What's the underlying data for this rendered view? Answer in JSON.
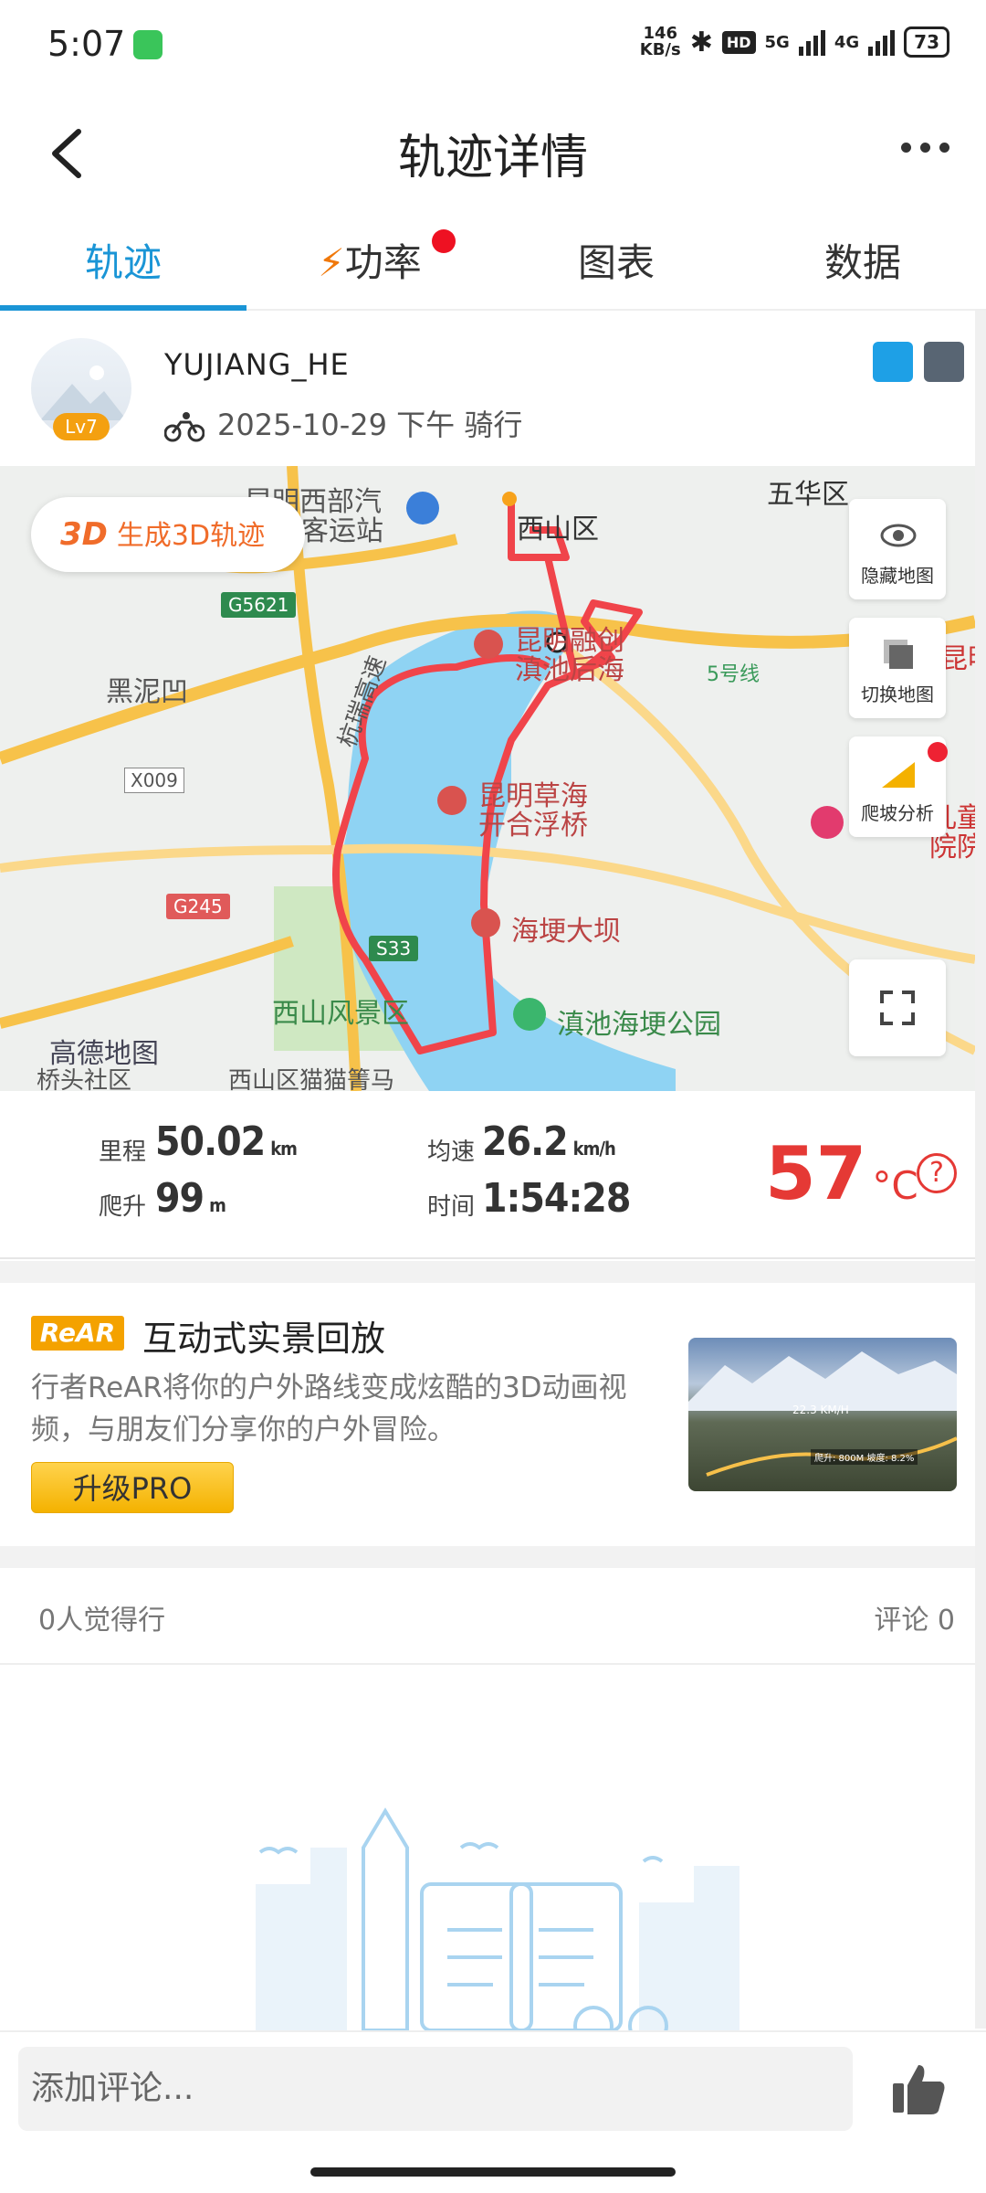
{
  "status_bar": {
    "time": "5:07",
    "net_speed_top": "146",
    "net_speed_bottom": "KB/s",
    "hd": "HD",
    "sig1": "5G",
    "sig2": "4G",
    "battery": "73"
  },
  "header": {
    "title": "轨迹详情"
  },
  "tabs": [
    {
      "label": "轨迹",
      "active": true
    },
    {
      "label": "功率",
      "active": false
    },
    {
      "label": "图表",
      "active": false
    },
    {
      "label": "数据",
      "active": false
    }
  ],
  "user": {
    "name": "YUJIANG_HE",
    "level": "Lv7",
    "meta": "2025-10-29 下午 骑行"
  },
  "map": {
    "button_3d_prefix": "3D",
    "button_3d": "生成3D轨迹",
    "hide_map": "隐藏地图",
    "switch_map": "切换地图",
    "climb": "爬坡分析",
    "labels": {
      "l1": "昆明西部汽",
      "l2": "车客运站",
      "l3": "西山区",
      "l4": "五华区",
      "l5": "G5621",
      "l6": "黑泥凹",
      "l7": "昆明融创",
      "l8": "滇池后海",
      "l9": "5号线",
      "l10": "X009",
      "l11": "昆明草海",
      "l12": "开合浮桥",
      "l13": "G245",
      "l14": "海埂大坝",
      "l15": "S33",
      "l16": "西山风景区",
      "l17": "滇池海埂公园",
      "l18": "高德地图",
      "l19": "桥头社区",
      "l20": "西山区猫猫箐马",
      "l21": "儿童",
      "l22": "院院区",
      "l23": "昆明",
      "l24": "杭瑞高速"
    }
  },
  "stats": {
    "distance_label": "里程",
    "distance": "50.02",
    "distance_unit": "km",
    "climb_label": "爬升",
    "climb": "99",
    "climb_unit": "m",
    "speed_label": "均速",
    "speed": "26.2",
    "speed_unit": "km/h",
    "time_label": "时间",
    "time": "1:54:28",
    "temperature": "57",
    "temperature_unit": "°C",
    "help": "?"
  },
  "rear": {
    "logo": "ReAR",
    "title": "互动式实景回放",
    "desc": "行者ReAR将你的户外路线变成炫酷的3D动画视频，与朋友们分享你的户外冒险。",
    "button": "升级PRO",
    "img_speed": "22.3 KM/H",
    "img_info": "爬升: 800M  坡度: 8.2%"
  },
  "social": {
    "likes": "0人觉得行",
    "comments": "评论 0"
  },
  "comment": {
    "placeholder": "添加评论..."
  }
}
